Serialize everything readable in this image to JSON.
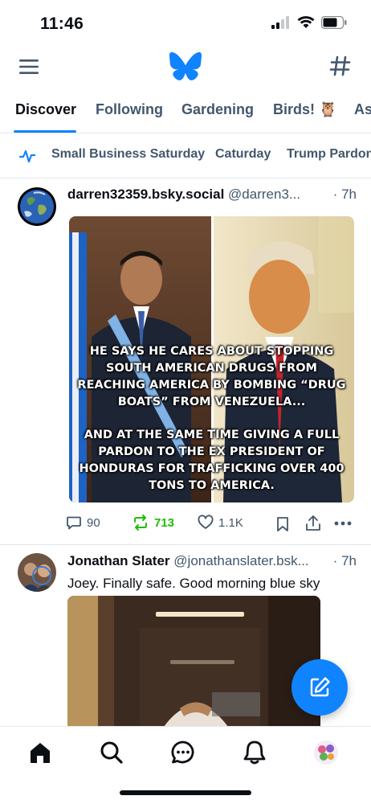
{
  "status": {
    "time": "11:46"
  },
  "tabs": [
    "Discover",
    "Following",
    "Gardening",
    "Birds! 🦉",
    "As"
  ],
  "trending": [
    "Small Business Saturday",
    "Caturday",
    "Trump Pardon"
  ],
  "posts": [
    {
      "name": "darren32359.bsky.social",
      "handle": "@darren3...",
      "time": "· 7h",
      "image_caption_1": "He says he cares about stopping South American drugs from reaching America by bombing “drug boats” from Venezuela...",
      "image_caption_2": "And at the same time giving a full pardon to the ex president of Honduras for trafficking over 400 tons to America.",
      "replies": "90",
      "reposts": "713",
      "likes": "1.1K"
    },
    {
      "name": "Jonathan Slater",
      "handle": "@jonathanslater.bsk...",
      "time": "· 7h",
      "text": "Joey. Finally safe. Good morning blue sky"
    }
  ],
  "colors": {
    "accent": "#1083fe",
    "repost": "#20bc07",
    "muted": "#42576c"
  }
}
